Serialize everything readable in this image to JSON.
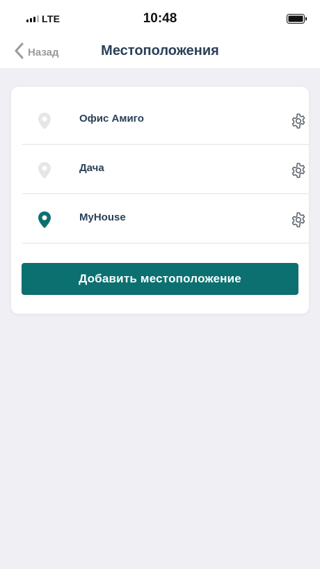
{
  "status_bar": {
    "network": "LTE",
    "time": "10:48"
  },
  "nav": {
    "back_label": "Назад",
    "title": "Местоположения"
  },
  "locations": [
    {
      "name": "Офис Амиго",
      "pin_icon": "location-pin-icon",
      "active": false
    },
    {
      "name": "Дача",
      "pin_icon": "location-pin-icon",
      "active": false
    },
    {
      "name": "MyHouse",
      "pin_icon": "location-pin-icon",
      "active": true
    }
  ],
  "add_button_label": "Добавить местоположение",
  "colors": {
    "accent": "#0d7070",
    "title": "#2b4058",
    "pin_inactive": "#e6e6e6",
    "background": "#efeff4"
  }
}
